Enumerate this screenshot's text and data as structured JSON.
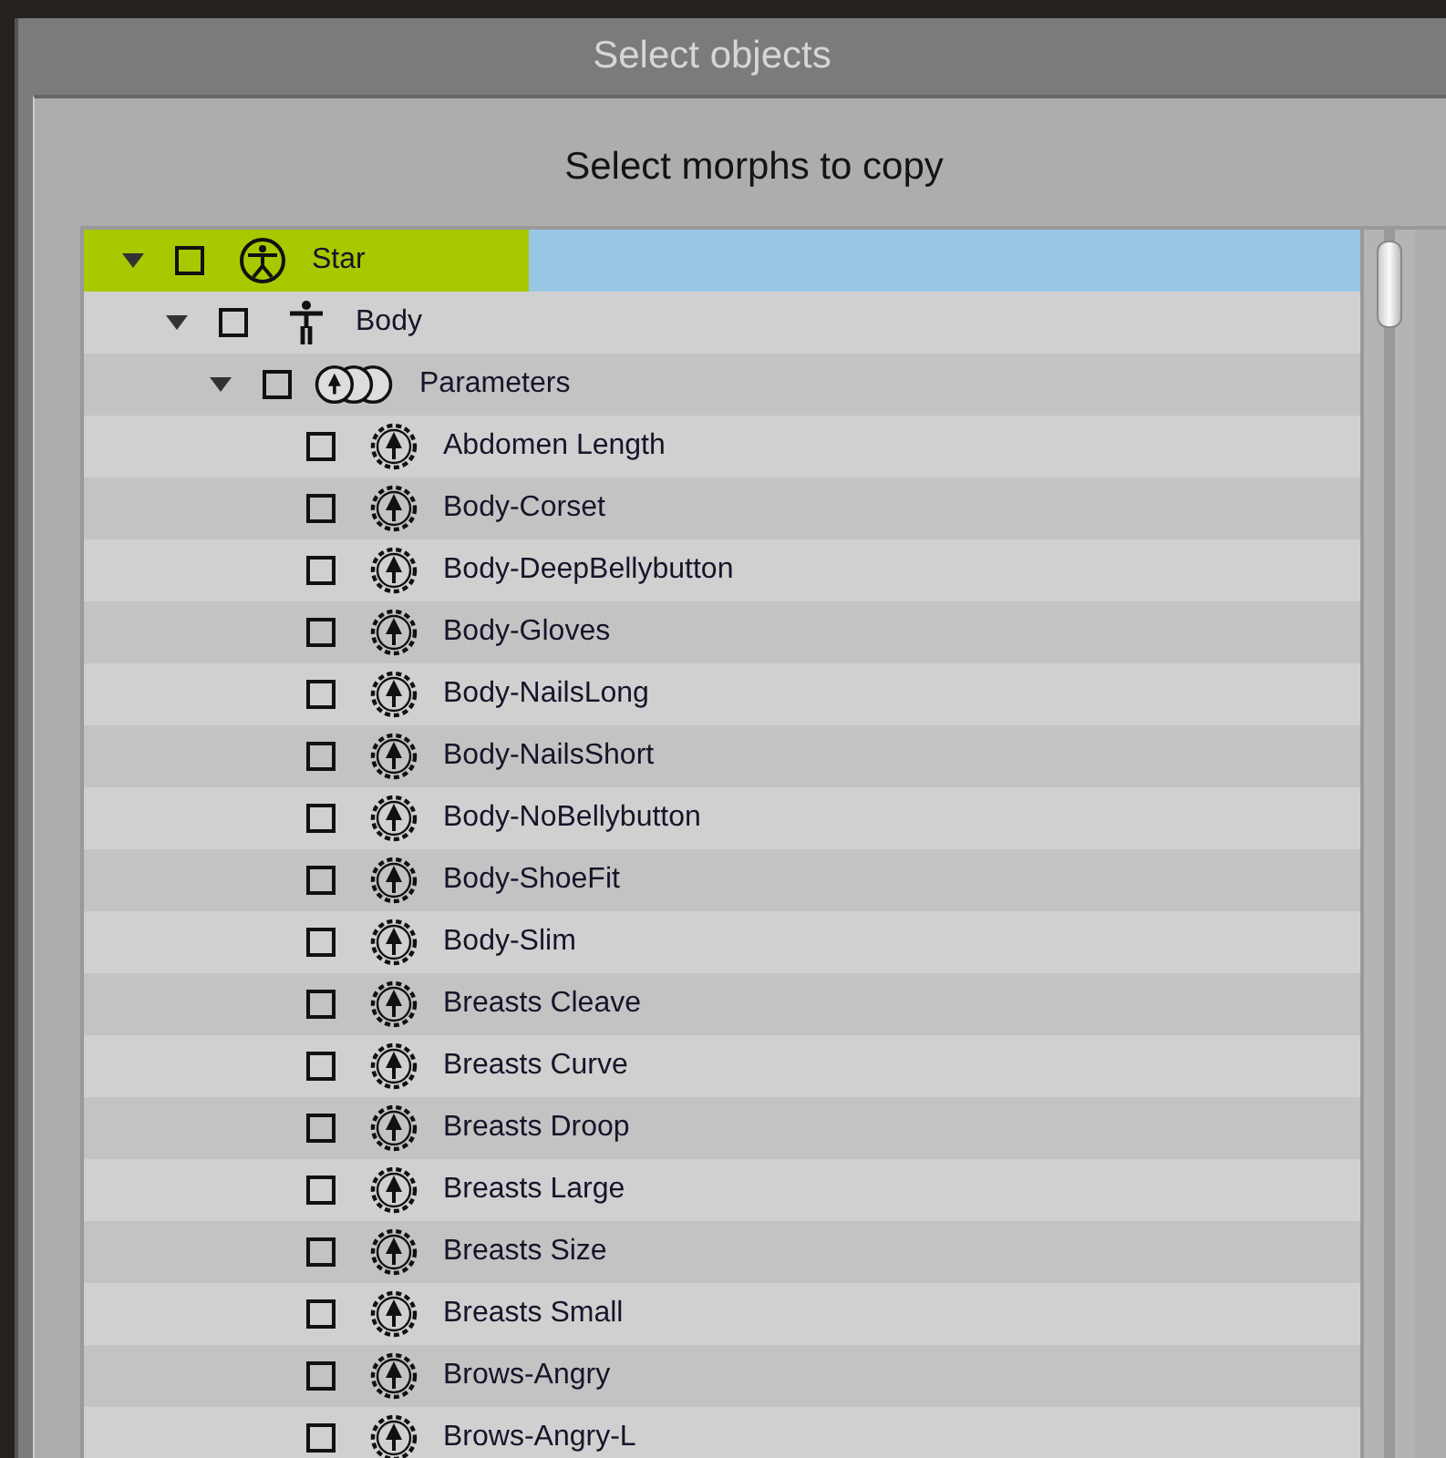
{
  "window": {
    "title": "Select objects"
  },
  "heading": "Select morphs to copy",
  "tree": [
    {
      "label": "Star",
      "kind": "figure",
      "checked": false,
      "expanded": true,
      "selected": true,
      "highlighted": true,
      "children": [
        {
          "label": "Body",
          "kind": "body",
          "checked": false,
          "expanded": true,
          "selected": false,
          "highlighted": false,
          "children": [
            {
              "label": "Parameters",
              "kind": "group",
              "checked": false,
              "expanded": true,
              "selected": false,
              "highlighted": false,
              "children": [
                {
                  "label": "Abdomen Length",
                  "kind": "morph",
                  "checked": false,
                  "selected": false,
                  "highlighted": false
                },
                {
                  "label": "Body-Corset",
                  "kind": "morph",
                  "checked": false,
                  "selected": false,
                  "highlighted": false
                },
                {
                  "label": "Body-DeepBellybutton",
                  "kind": "morph",
                  "checked": false,
                  "selected": false,
                  "highlighted": false
                },
                {
                  "label": "Body-Gloves",
                  "kind": "morph",
                  "checked": false,
                  "selected": false,
                  "highlighted": false
                },
                {
                  "label": "Body-NailsLong",
                  "kind": "morph",
                  "checked": false,
                  "selected": false,
                  "highlighted": false
                },
                {
                  "label": "Body-NailsShort",
                  "kind": "morph",
                  "checked": false,
                  "selected": false,
                  "highlighted": false
                },
                {
                  "label": "Body-NoBellybutton",
                  "kind": "morph",
                  "checked": false,
                  "selected": false,
                  "highlighted": false
                },
                {
                  "label": "Body-ShoeFit",
                  "kind": "morph",
                  "checked": false,
                  "selected": false,
                  "highlighted": false
                },
                {
                  "label": "Body-Slim",
                  "kind": "morph",
                  "checked": false,
                  "selected": false,
                  "highlighted": false
                },
                {
                  "label": "Breasts Cleave",
                  "kind": "morph",
                  "checked": false,
                  "selected": false,
                  "highlighted": false
                },
                {
                  "label": "Breasts Curve",
                  "kind": "morph",
                  "checked": false,
                  "selected": false,
                  "highlighted": false
                },
                {
                  "label": "Breasts Droop",
                  "kind": "morph",
                  "checked": false,
                  "selected": false,
                  "highlighted": false
                },
                {
                  "label": "Breasts Large",
                  "kind": "morph",
                  "checked": false,
                  "selected": false,
                  "highlighted": false
                },
                {
                  "label": "Breasts Size",
                  "kind": "morph",
                  "checked": false,
                  "selected": false,
                  "highlighted": false
                },
                {
                  "label": "Breasts Small",
                  "kind": "morph",
                  "checked": false,
                  "selected": false,
                  "highlighted": false
                },
                {
                  "label": "Brows-Angry",
                  "kind": "morph",
                  "checked": false,
                  "selected": false,
                  "highlighted": false
                },
                {
                  "label": "Brows-Angry-L",
                  "kind": "morph",
                  "checked": false,
                  "selected": false,
                  "highlighted": false
                }
              ]
            }
          ]
        }
      ]
    }
  ]
}
